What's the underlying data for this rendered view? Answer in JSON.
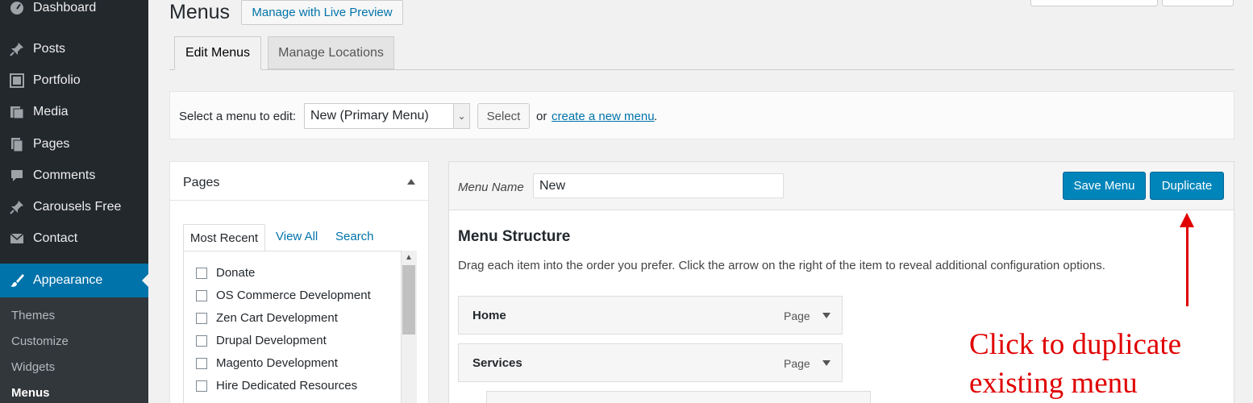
{
  "sidebar": {
    "items": [
      {
        "label": "Dashboard",
        "icon": "dashboard-icon"
      },
      {
        "label": "Posts",
        "icon": "pin-icon"
      },
      {
        "label": "Portfolio",
        "icon": "portfolio-icon"
      },
      {
        "label": "Media",
        "icon": "media-icon"
      },
      {
        "label": "Pages",
        "icon": "pages-icon"
      },
      {
        "label": "Comments",
        "icon": "comment-icon"
      },
      {
        "label": "Carousels Free",
        "icon": "pin-icon"
      },
      {
        "label": "Contact",
        "icon": "mail-icon"
      },
      {
        "label": "Appearance",
        "icon": "paintbrush-icon"
      }
    ],
    "submenu": [
      "Themes",
      "Customize",
      "Widgets",
      "Menus"
    ]
  },
  "header": {
    "title": "Menus",
    "live_preview": "Manage with Live Preview"
  },
  "tabs": [
    {
      "label": "Edit Menus"
    },
    {
      "label": "Manage Locations"
    }
  ],
  "select_bar": {
    "label": "Select a menu to edit:",
    "selected": "New (Primary Menu)",
    "select_button": "Select",
    "or": "or",
    "create_link": "create a new menu",
    "period": "."
  },
  "pages_box": {
    "title": "Pages",
    "tabs": [
      "Most Recent",
      "View All",
      "Search"
    ],
    "items": [
      "Donate",
      "OS Commerce Development",
      "Zen Cart Development",
      "Drupal Development",
      "Magento Development",
      "Hire Dedicated Resources"
    ]
  },
  "edit": {
    "menu_name_label": "Menu Name",
    "menu_name_value": "New",
    "save_button": "Save Menu",
    "duplicate_button": "Duplicate",
    "structure_title": "Menu Structure",
    "structure_desc": "Drag each item into the order you prefer. Click the arrow on the right of the item to reveal additional configuration options.",
    "menu_items": [
      {
        "title": "Home",
        "type": "Page"
      },
      {
        "title": "Services",
        "type": "Page"
      }
    ]
  },
  "annotation": {
    "line1": "Click to duplicate",
    "line2": "existing menu",
    "color": "#e00000"
  }
}
